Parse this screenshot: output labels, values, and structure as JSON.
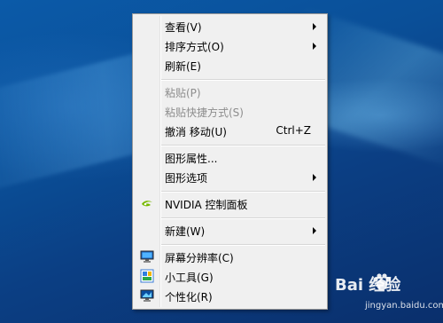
{
  "menu": {
    "items": [
      {
        "label": "查看(V)"
      },
      {
        "label": "排序方式(O)"
      },
      {
        "label": "刷新(E)"
      },
      {
        "label": "粘贴(P)"
      },
      {
        "label": "粘贴快捷方式(S)"
      },
      {
        "label": "撤消 移动(U)",
        "shortcut": "Ctrl+Z"
      },
      {
        "label": "图形属性..."
      },
      {
        "label": "图形选项"
      },
      {
        "label": "NVIDIA 控制面板"
      },
      {
        "label": "新建(W)"
      },
      {
        "label": "屏幕分辨率(C)"
      },
      {
        "label": "小工具(G)"
      },
      {
        "label": "个性化(R)"
      }
    ]
  },
  "icons": {
    "nvidia": "nvidia-logo-icon",
    "screen_resolution": "monitor-icon",
    "gadgets": "gadgets-icon",
    "personalize": "personalize-icon"
  },
  "watermark": {
    "logo_text": "Bai 经验",
    "url": "jingyan.baidu.com"
  },
  "colors": {
    "menu_bg": "#f0f0f0",
    "disabled_text": "#8d8d8d",
    "desktop_blue": "#0a4f98",
    "nvidia_green": "#76b900"
  }
}
